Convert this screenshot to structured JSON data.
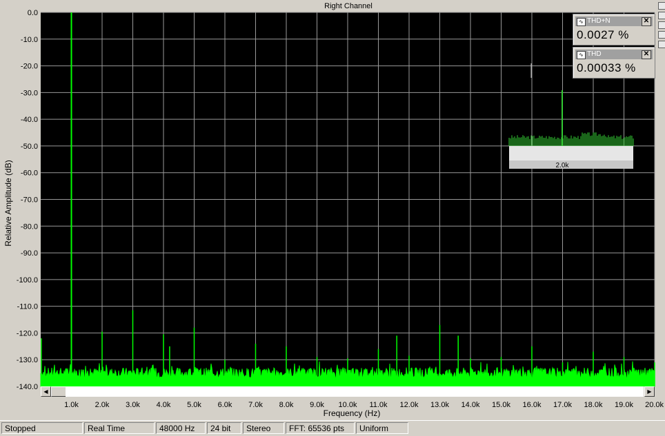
{
  "meters": [
    {
      "title": "THD+N",
      "value": "0.0027 %"
    },
    {
      "title": "THD",
      "value": "0.00033 %"
    }
  ],
  "inset": {
    "tick_label": "2.0k"
  },
  "status_bar": [
    "Stopped",
    "Real Time",
    "48000 Hz",
    "24 bit",
    "Stereo",
    "FFT: 65536 pts",
    "Uniform"
  ],
  "colors": {
    "background": "#000000",
    "trace": "#00ff00",
    "grid": "#a0a0a0",
    "chrome": "#d4d0c8"
  },
  "chart_data": {
    "type": "line",
    "title": "Right Channel",
    "xlabel": "Frequency (Hz)",
    "ylabel": "Relative Amplitude (dB)",
    "xlim": [
      0,
      20000
    ],
    "ylim": [
      -140,
      0
    ],
    "x_ticks": [
      1000,
      2000,
      3000,
      4000,
      5000,
      6000,
      7000,
      8000,
      9000,
      10000,
      11000,
      12000,
      13000,
      14000,
      15000,
      16000,
      17000,
      18000,
      19000,
      20000
    ],
    "x_tick_labels": [
      "1.0k",
      "2.0k",
      "3.0k",
      "4.0k",
      "5.0k",
      "6.0k",
      "7.0k",
      "8.0k",
      "9.0k",
      "10.0k",
      "11.0k",
      "12.0k",
      "13.0k",
      "14.0k",
      "15.0k",
      "16.0k",
      "17.0k",
      "18.0k",
      "19.0k",
      "20.0k"
    ],
    "y_ticks": [
      0,
      -10,
      -20,
      -30,
      -40,
      -50,
      -60,
      -70,
      -80,
      -90,
      -100,
      -110,
      -120,
      -130,
      -140
    ],
    "y_tick_labels": [
      "0.0",
      "-10.0",
      "-20.0",
      "-30.0",
      "-40.0",
      "-50.0",
      "-60.0",
      "-70.0",
      "-80.0",
      "-90.0",
      "-100.0",
      "-110.0",
      "-120.0",
      "-130.0",
      "-140.0"
    ],
    "grid": true,
    "noise_floor_db": -135,
    "peaks": [
      {
        "x": 20,
        "y": -122
      },
      {
        "x": 1000,
        "y": 0
      },
      {
        "x": 2000,
        "y": -119.5
      },
      {
        "x": 3000,
        "y": -111.5
      },
      {
        "x": 4000,
        "y": -120.5
      },
      {
        "x": 4200,
        "y": -125
      },
      {
        "x": 5000,
        "y": -118
      },
      {
        "x": 6000,
        "y": -130
      },
      {
        "x": 7000,
        "y": -124
      },
      {
        "x": 8000,
        "y": -125
      },
      {
        "x": 9000,
        "y": -129
      },
      {
        "x": 10000,
        "y": -129.5
      },
      {
        "x": 11000,
        "y": -126
      },
      {
        "x": 11600,
        "y": -121
      },
      {
        "x": 12000,
        "y": -128.5
      },
      {
        "x": 13000,
        "y": -117
      },
      {
        "x": 13600,
        "y": -121
      },
      {
        "x": 14000,
        "y": -129.5
      },
      {
        "x": 15000,
        "y": -129
      },
      {
        "x": 16000,
        "y": -125
      },
      {
        "x": 17000,
        "y": -131
      },
      {
        "x": 18000,
        "y": -127
      },
      {
        "x": 19000,
        "y": -129
      },
      {
        "x": 20000,
        "y": -131
      }
    ]
  }
}
